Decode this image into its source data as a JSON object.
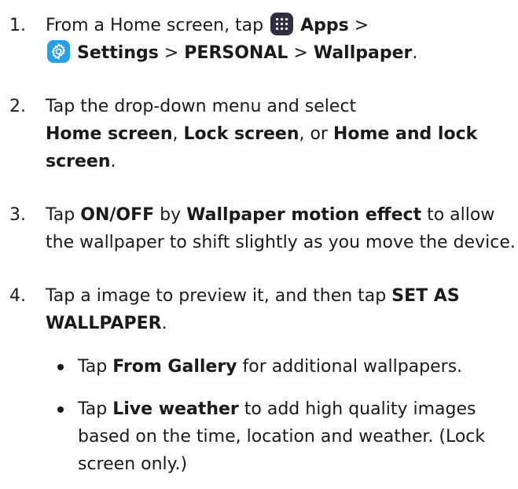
{
  "steps": [
    {
      "number": "1.",
      "text": {
        "a": "From a Home screen, tap",
        "apps": "Apps",
        "sep1": ">",
        "settings": "Settings",
        "sep2": ">",
        "personal": "PERSONAL",
        "sep3": ">",
        "wallpaper": "Wallpaper",
        "end": "."
      },
      "icons": [
        "apps-icon",
        "settings-icon"
      ]
    },
    {
      "number": "2.",
      "text": {
        "a": "Tap the drop-down menu and select",
        "home": "Home screen",
        "comma1": ",",
        "lock": "Lock screen",
        "or": ", or",
        "both": "Home and lock screen",
        "end": "."
      }
    },
    {
      "number": "3.",
      "text": {
        "a": "Tap",
        "onoff": "ON/OFF",
        "by": "by",
        "motion": "Wallpaper motion effect",
        "rest": "to allow the wallpaper to shift slightly as you move the device."
      }
    },
    {
      "number": "4.",
      "text": {
        "a": "Tap a image to preview it, and then tap",
        "set": "SET AS WALLPAPER",
        "end": "."
      },
      "bullets": [
        {
          "a": "Tap",
          "b": "From Gallery",
          "c": "for additional wallpapers."
        },
        {
          "a": "Tap",
          "b": "Live weather",
          "c": "to add high quality images based on the time, location and weather. (Lock screen only.)"
        }
      ]
    }
  ]
}
